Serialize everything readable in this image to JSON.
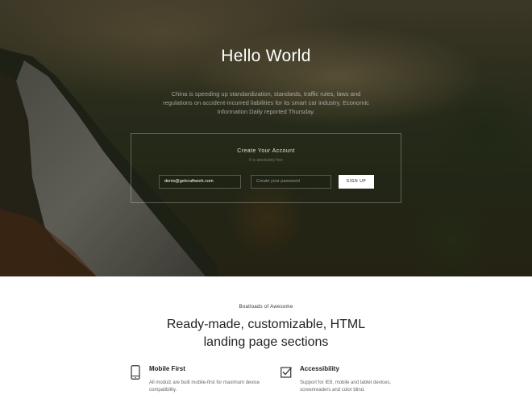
{
  "hero": {
    "title": "Hello World",
    "text": "China is speeding up standardization, standards, traffic rules, laws and regulations on accident-incurred liabilities for its smart car industry, Economic Information Daily reported Thursday."
  },
  "signup": {
    "title": "Create Your Account",
    "subtitle": "It is absolutely free",
    "email_value": "denis@getcraftwork.com",
    "password_placeholder": "Create your password",
    "button_label": "SIGN UP"
  },
  "section": {
    "eyebrow": "Boatloads of Awesome",
    "headline_line1": "Ready-made, customizable, HTML",
    "headline_line2": "landing page sections"
  },
  "features": [
    {
      "icon": "mobile-icon",
      "title": "Mobile First",
      "description": "All modulz are built mobile-first for maximum device compatibility."
    },
    {
      "icon": "checkbox-icon",
      "title": "Accessibility",
      "description": "Support for IE8, mobile and tablet devices, screenreaders and color blind."
    }
  ]
}
